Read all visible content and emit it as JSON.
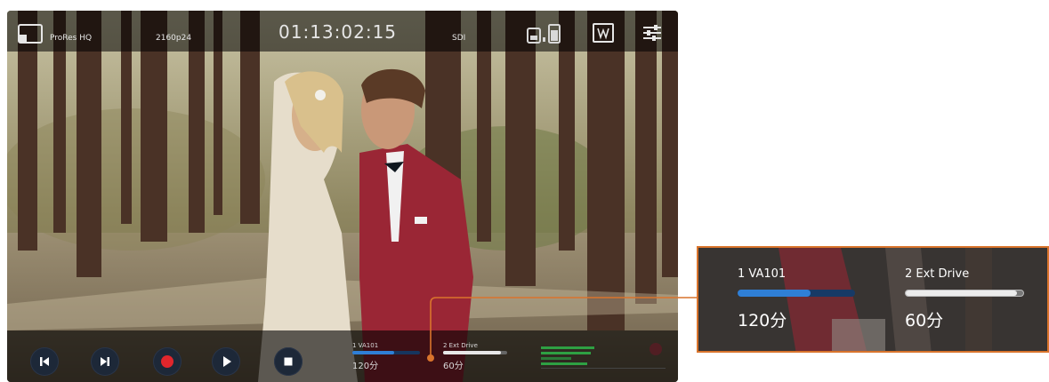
{
  "monitor": {
    "top_bar": {
      "codec": "ProRes HQ",
      "resolution": "2160p24",
      "timecode": "01:13:02:15",
      "input": "SDI"
    },
    "transport": {
      "buttons": [
        "skip-back",
        "skip-forward",
        "record",
        "play",
        "stop"
      ]
    },
    "slots": [
      {
        "name": "1  VA101",
        "time": "120分",
        "fill": 0.62,
        "color": "#2f7fd6"
      },
      {
        "name": "2  Ext Drive",
        "time": "60分",
        "fill": 0.9,
        "color": "#e8e8e8"
      }
    ]
  },
  "callout": {
    "slots": [
      {
        "name": "1  VA101",
        "time": "120分",
        "fill": 0.62,
        "color": "#2f7fd6"
      },
      {
        "name": "2  Ext Drive",
        "time": "60分",
        "fill": 0.95,
        "color": "#ececec"
      }
    ],
    "accent": "#d9742c"
  }
}
